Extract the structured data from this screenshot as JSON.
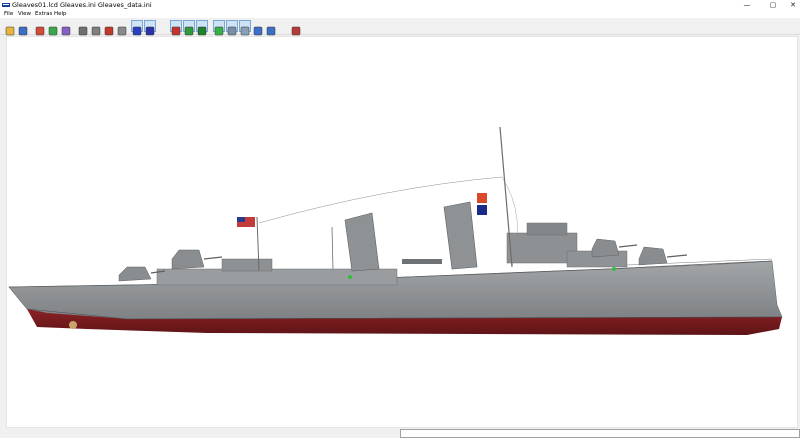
{
  "window": {
    "title": "Gleaves01.lcd  Gleaves.ini  Gleaves_data.ini",
    "minimize_glyph": "—",
    "maximize_glyph": "▢",
    "close_glyph": "✕"
  },
  "menu": {
    "items": [
      {
        "label": "File"
      },
      {
        "label": "View"
      },
      {
        "label": "Extras"
      },
      {
        "label": "Help"
      }
    ]
  },
  "toolbar": {
    "buttons": [
      {
        "icon": "open-folder-icon",
        "color": "#e8b53c"
      },
      {
        "icon": "save-icon",
        "color": "#3a6fc4"
      },
      {
        "icon": "add-object-icon",
        "color": "#d34a3a"
      },
      {
        "icon": "edit-object-icon",
        "color": "#3aa84a"
      },
      {
        "icon": "delete-object-icon",
        "color": "#8a5fc4"
      },
      {
        "icon": "solid-shade-1-icon",
        "color": "#707070"
      },
      {
        "icon": "solid-shade-2-icon",
        "color": "#808080"
      },
      {
        "icon": "solid-red-icon",
        "color": "#c0392b"
      },
      {
        "icon": "solid-shade-3-icon",
        "color": "#8a8a8a"
      },
      {
        "icon": "blue-box-1-icon",
        "color": "#2c3ec4"
      },
      {
        "icon": "blue-box-2-icon",
        "color": "#2a32a8"
      },
      {
        "icon": "red-box-icon",
        "color": "#c4342c"
      },
      {
        "icon": "green-box-1-icon",
        "color": "#2e9a3a"
      },
      {
        "icon": "green-box-2-icon",
        "color": "#1f7f2d"
      },
      {
        "icon": "green-box-3-icon",
        "color": "#38b04a"
      },
      {
        "icon": "layer-view-1-icon",
        "color": "#7a8ea8"
      },
      {
        "icon": "layer-view-2-icon",
        "color": "#8aa0b8"
      },
      {
        "icon": "axes-icon",
        "color": "#3c6ec8"
      },
      {
        "icon": "cube-icon",
        "color": "#3c6ec8"
      },
      {
        "icon": "tools-icon",
        "color": "#b83a3a"
      }
    ]
  }
}
